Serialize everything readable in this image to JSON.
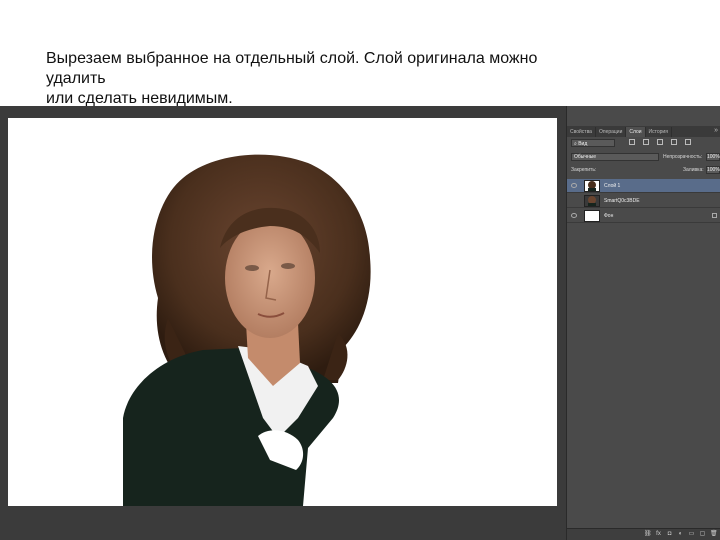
{
  "caption": {
    "line1": "Вырезаем выбранное на отдельный слой. Слой оригинала можно",
    "line2": "удалить",
    "line3": "или сделать невидимым."
  },
  "panel": {
    "tabs": [
      "Свойства",
      "Операции",
      "Слои",
      "История"
    ],
    "active_tab": "Слои",
    "collapse_icon": "double-chevron-right",
    "filter": {
      "kind": "Вид",
      "icons": [
        "image-filter-icon",
        "adjustment-filter-icon",
        "type-filter-icon",
        "shape-filter-icon",
        "smart-filter-icon"
      ]
    },
    "blend_mode": "Обычные",
    "opacity_label": "Непрозрачность:",
    "opacity_value": "100%",
    "lock_label": "Закрепить:",
    "fill_label": "Заливка:",
    "fill_value": "100%",
    "layers": [
      {
        "name": "Слой 1",
        "visible": true,
        "selected": true
      },
      {
        "name": "SmartQ0c3BDE",
        "visible": false,
        "selected": false
      },
      {
        "name": "Фон",
        "visible": true,
        "selected": false,
        "locked": true
      }
    ],
    "footer_icons": [
      "link-icon",
      "fx-icon",
      "mask-icon",
      "adjustment-icon",
      "folder-icon",
      "new-layer-icon",
      "trash-icon"
    ]
  },
  "colors": {
    "workspace": "#3b3b3b",
    "panel": "#4a4a4a",
    "selected_layer": "#596c8a",
    "hair": "#4a2f1d",
    "jacket": "#16241d"
  }
}
